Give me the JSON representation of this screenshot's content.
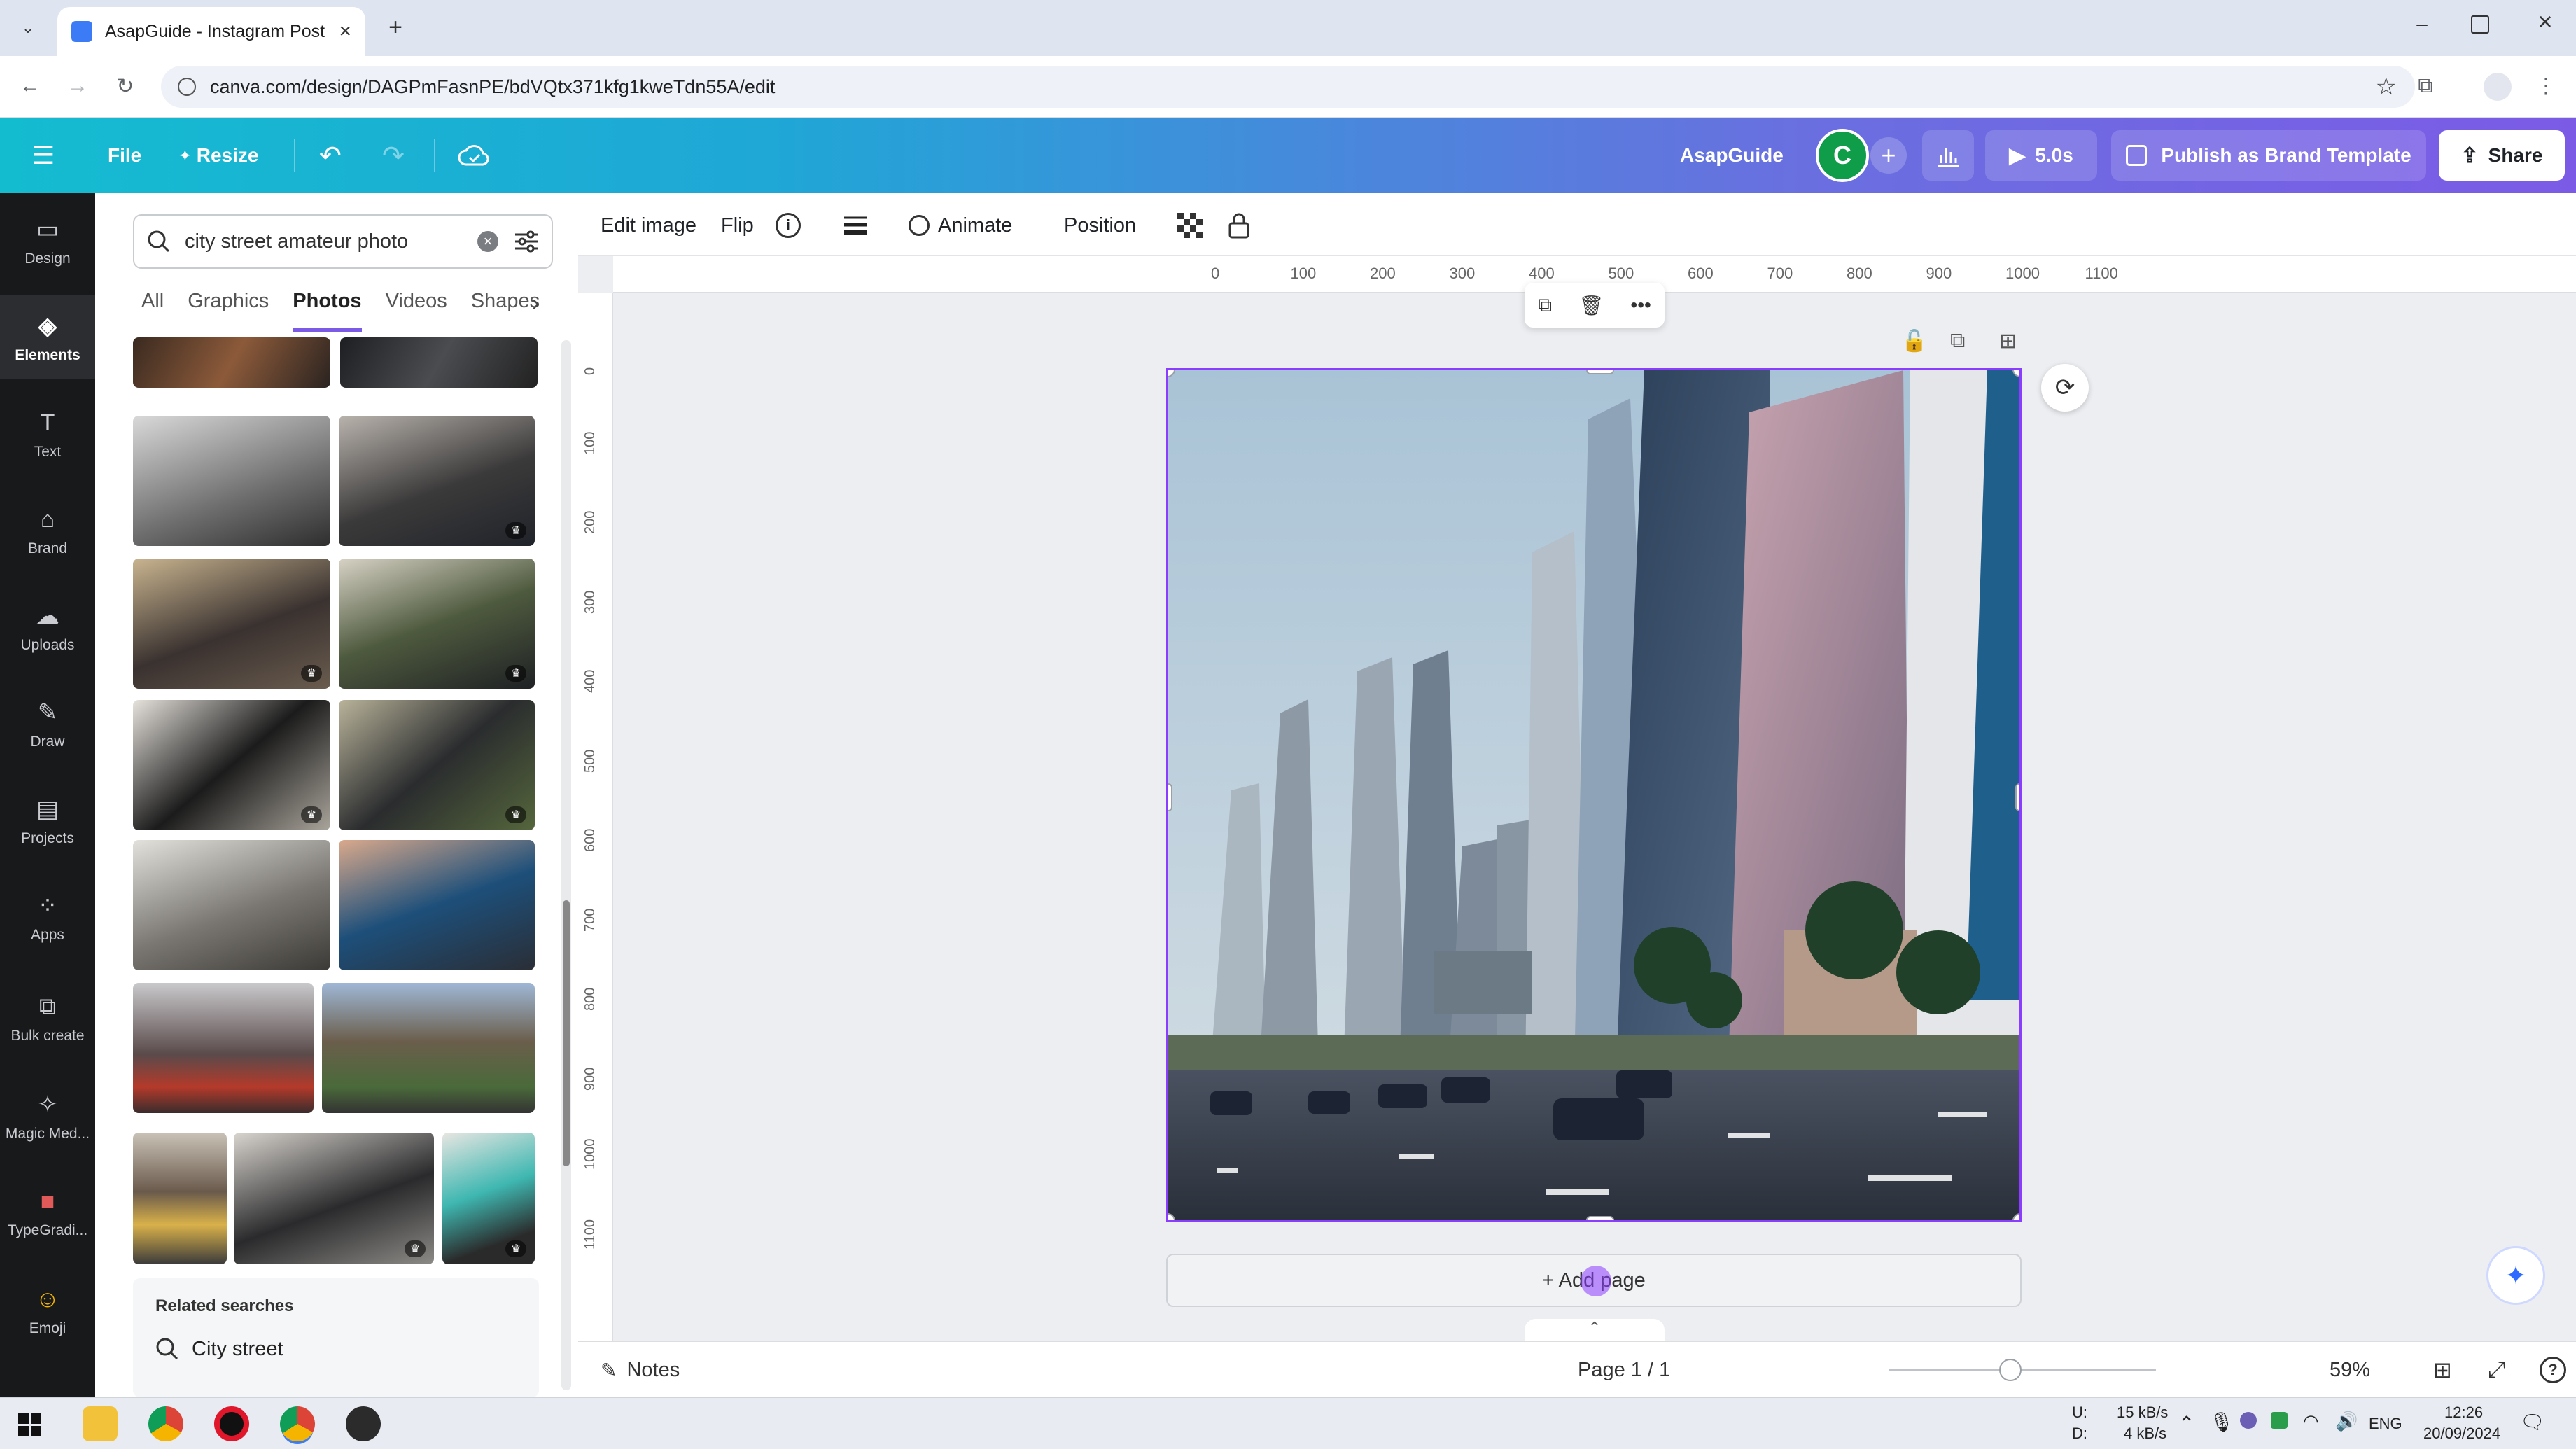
{
  "browser": {
    "tab_title": "AsapGuide - Instagram Post",
    "new_tab_icon": "plus-icon",
    "url": "canva.com/design/DAGPmFasnPE/bdVQtx371kfg1kweTdn55A/edit",
    "window_controls": [
      "minimize",
      "restore",
      "close"
    ]
  },
  "topbar": {
    "menu_icon": "hamburger-icon",
    "file_label": "File",
    "resize_label": "Resize",
    "design_name": "AsapGuide",
    "avatar_letter": "C",
    "timer_label": "5.0s",
    "publish_label": "Publish as Brand Template",
    "share_label": "Share"
  },
  "rail": [
    {
      "label": "Design",
      "icon": "design-icon"
    },
    {
      "label": "Elements",
      "icon": "elements-icon",
      "active": true
    },
    {
      "label": "Text",
      "icon": "text-icon"
    },
    {
      "label": "Brand",
      "icon": "brand-icon"
    },
    {
      "label": "Uploads",
      "icon": "uploads-icon"
    },
    {
      "label": "Draw",
      "icon": "draw-icon"
    },
    {
      "label": "Projects",
      "icon": "projects-icon"
    },
    {
      "label": "Apps",
      "icon": "apps-icon"
    },
    {
      "label": "Bulk create",
      "icon": "bulk-create-icon"
    },
    {
      "label": "Magic Med...",
      "icon": "magic-media-icon"
    },
    {
      "label": "TypeGradi...",
      "icon": "typegradient-icon"
    },
    {
      "label": "Emoji",
      "icon": "emoji-icon"
    }
  ],
  "panel": {
    "search_value": "city street amateur photo",
    "tabs": [
      "All",
      "Graphics",
      "Photos",
      "Videos",
      "Shapes"
    ],
    "active_tab": "Photos",
    "related_title": "Related searches",
    "related_items": [
      "City street"
    ]
  },
  "context_toolbar": {
    "edit_image": "Edit image",
    "flip": "Flip",
    "animate": "Animate",
    "position": "Position"
  },
  "ruler": {
    "top": [
      "0",
      "100",
      "200",
      "300",
      "400",
      "500",
      "600",
      "700",
      "800",
      "900",
      "1000",
      "1100"
    ],
    "left": [
      "0",
      "100",
      "200",
      "300",
      "400",
      "500",
      "600",
      "700",
      "800",
      "900",
      "1000",
      "1100"
    ]
  },
  "canvas": {
    "add_page_label": "+ Add page"
  },
  "status": {
    "notes_label": "Notes",
    "page_indicator": "Page 1 / 1",
    "zoom": "59%",
    "zoom_level": 0.59
  },
  "taskbar": {
    "net_up_label": "U:",
    "net_down_label": "D:",
    "net_up": "15 kB/s",
    "net_down": "4 kB/s",
    "language": "ENG",
    "time": "12:26",
    "date": "20/09/2024"
  },
  "colors": {
    "accent": "#8b3dff",
    "topbar_start": "#14bcd0",
    "topbar_end": "#7b5be6",
    "rail_bg": "#18191b"
  }
}
